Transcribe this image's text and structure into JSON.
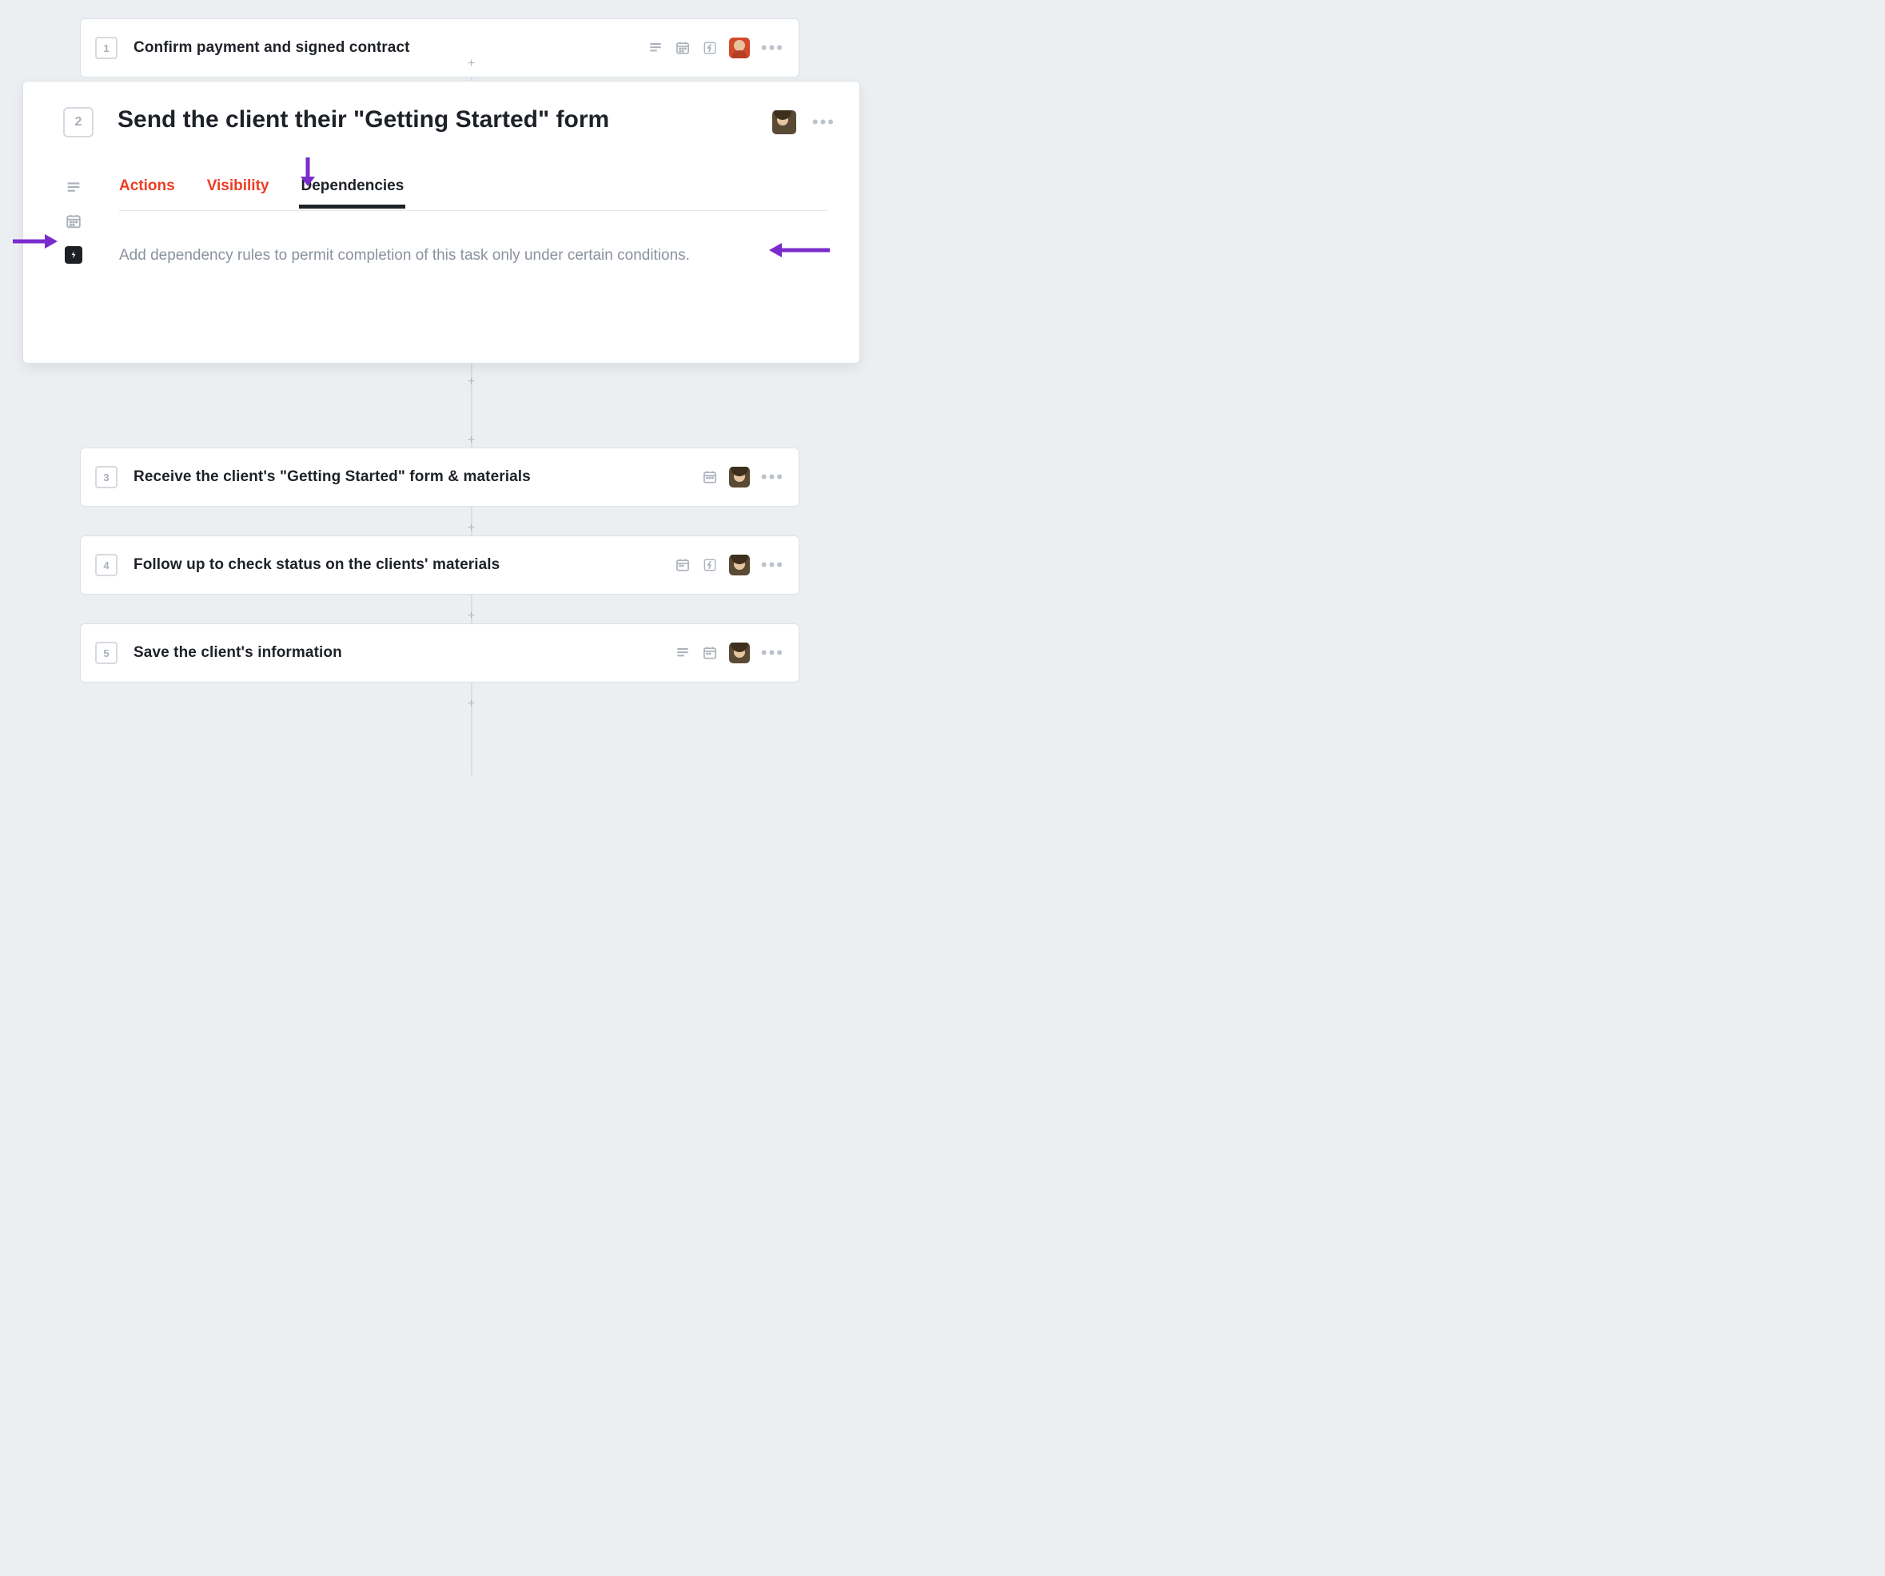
{
  "steps": [
    {
      "num": "1",
      "title": "Confirm payment and signed contract"
    },
    {
      "num": "2",
      "title": "Send the client their \"Getting Started\" form"
    },
    {
      "num": "3",
      "title": "Receive the client's \"Getting Started\" form & materials"
    },
    {
      "num": "4",
      "title": "Follow up to check status on the clients' materials"
    },
    {
      "num": "5",
      "title": "Save the client's information"
    }
  ],
  "expanded": {
    "tabs": {
      "actions": "Actions",
      "visibility": "Visibility",
      "dependencies": "Dependencies"
    },
    "description": "Add dependency rules to permit completion of this task only under certain conditions."
  }
}
